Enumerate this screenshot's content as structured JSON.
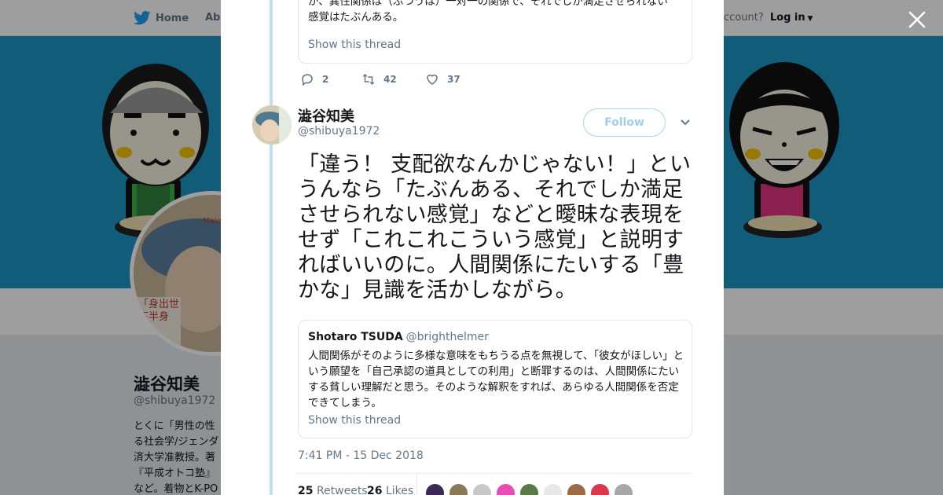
{
  "nav": {
    "home_label": "Home",
    "about_label": "Abo",
    "account_prompt": "ccount?",
    "login_label": "Log in"
  },
  "background_profile": {
    "name": "澁谷知美",
    "handle": "@shibuya1972",
    "bio": "とくに「男性の性\nる社会学/ジェンダ\n済大学准教授。著\n『平成オトコ塾』\nなど。着物とK-PO",
    "avatar_caption_top": "Male S",
    "avatar_caption_bottom": "「身出世\n下半身"
  },
  "modal": {
    "prev_tweet": {
      "quote_text": "が、異性関係は（ふつうは）一対一の関係で、それでしか満足させられない\n感覚はたぶんある。",
      "show_thread": "Show this thread",
      "replies": "2",
      "retweets": "42",
      "likes": "37"
    },
    "tweet": {
      "author_name": "澁谷知美",
      "author_handle": "@shibuya1972",
      "follow_label": "Follow",
      "text": "「違う！ 支配欲なんかじゃない！」というんなら「たぶんある、それでしか満足させられない感覚」などと曖昧な表現をせず「これこれこういう感覚」と説明すればいいのに。人間関係にたいする「豊かな」見識を活かしながら。",
      "quoted": {
        "name": "Shotaro TSUDA",
        "handle": "@brighthelmer",
        "text": "人間関係がそのように多様な意味をもちうる点を無視して、「彼女がほしい」という願望を「自己承認の道具としての利用」と断罪するのは、人間関係にたいする貧しい理解だと思う。そのような解釈をすれば、あらゆる人間関係を否定できてしまう。",
        "show_thread": "Show this thread"
      },
      "timestamp": "7:41 PM - 15 Dec 2018",
      "retweet_count": "25",
      "retweet_label": "Retweets",
      "like_count": "26",
      "like_label": "Likes"
    }
  },
  "colors": {
    "twitter_blue": "#1da1f2",
    "banner": "#1b95c4",
    "overlay": "rgba(0,0,0,0.38)"
  },
  "icons": [
    "twitter-bird-icon",
    "close-icon",
    "reply-icon",
    "retweet-icon",
    "like-icon",
    "chevron-down-icon"
  ]
}
